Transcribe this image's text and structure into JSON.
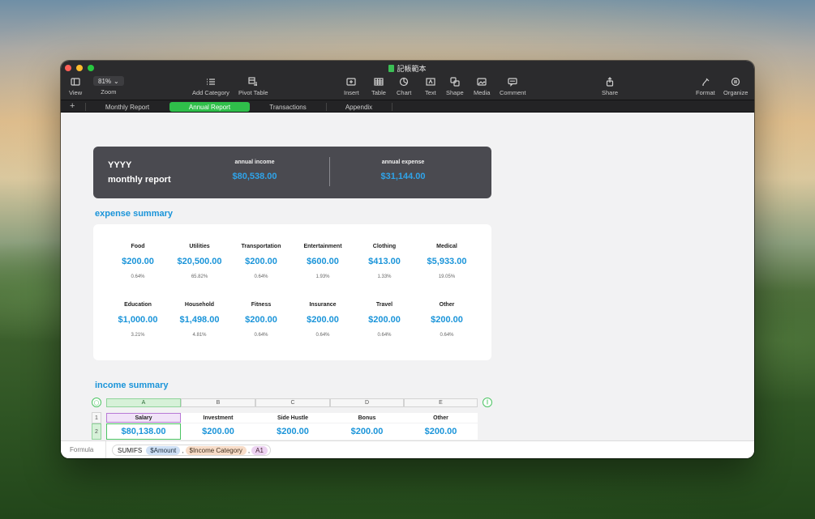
{
  "window": {
    "title": "記帳範本"
  },
  "toolbar": {
    "view": "View",
    "zoom_value": "81%",
    "zoom": "Zoom",
    "add_category": "Add Category",
    "pivot_table": "Pivot Table",
    "insert": "Insert",
    "table": "Table",
    "chart": "Chart",
    "text": "Text",
    "shape": "Shape",
    "media": "Media",
    "comment": "Comment",
    "share": "Share",
    "format": "Format",
    "organize": "Organize"
  },
  "tabs": {
    "add": "+",
    "items": [
      {
        "label": "Monthly Report"
      },
      {
        "label": "Annual Report"
      },
      {
        "label": "Transactions"
      },
      {
        "label": "Appendix"
      }
    ]
  },
  "hero": {
    "year": "YYYY",
    "subtitle": "monthly report",
    "income_label": "annual income",
    "income_value": "$80,538.00",
    "expense_label": "annual expense",
    "expense_value": "$31,144.00"
  },
  "expense_summary": {
    "title": "expense summary",
    "row1": [
      {
        "name": "Food",
        "value": "$200.00",
        "pct": "0.64%"
      },
      {
        "name": "Utilities",
        "value": "$20,500.00",
        "pct": "65.82%"
      },
      {
        "name": "Transportation",
        "value": "$200.00",
        "pct": "0.64%"
      },
      {
        "name": "Entertainment",
        "value": "$600.00",
        "pct": "1.93%"
      },
      {
        "name": "Clothing",
        "value": "$413.00",
        "pct": "1.33%"
      },
      {
        "name": "Medical",
        "value": "$5,933.00",
        "pct": "19.05%"
      }
    ],
    "row2": [
      {
        "name": "Education",
        "value": "$1,000.00",
        "pct": "3.21%"
      },
      {
        "name": "Household",
        "value": "$1,498.00",
        "pct": "4.81%"
      },
      {
        "name": "Fitness",
        "value": "$200.00",
        "pct": "0.64%"
      },
      {
        "name": "Insurance",
        "value": "$200.00",
        "pct": "0.64%"
      },
      {
        "name": "Travel",
        "value": "$200.00",
        "pct": "0.64%"
      },
      {
        "name": "Other",
        "value": "$200.00",
        "pct": "0.64%"
      }
    ]
  },
  "income_summary": {
    "title": "income summary",
    "columns": [
      "A",
      "B",
      "C",
      "D",
      "E"
    ],
    "rows": [
      "1",
      "2"
    ],
    "headers": [
      "Salary",
      "Investment",
      "Side Hustle",
      "Bonus",
      "Other"
    ],
    "values": [
      "$80,138.00",
      "$200.00",
      "$200.00",
      "$200.00",
      "$200.00"
    ],
    "freeze_glyph": "||"
  },
  "formula": {
    "label": "Formula",
    "function": "SUMIFS",
    "arg1": "$Amount",
    "comma": ",",
    "arg2": "$Income Category",
    "arg3": "A1"
  },
  "colors": {
    "accent_blue": "#1a94d9",
    "tab_active": "#2fbf4a",
    "hero_bg": "#4a4a50"
  }
}
